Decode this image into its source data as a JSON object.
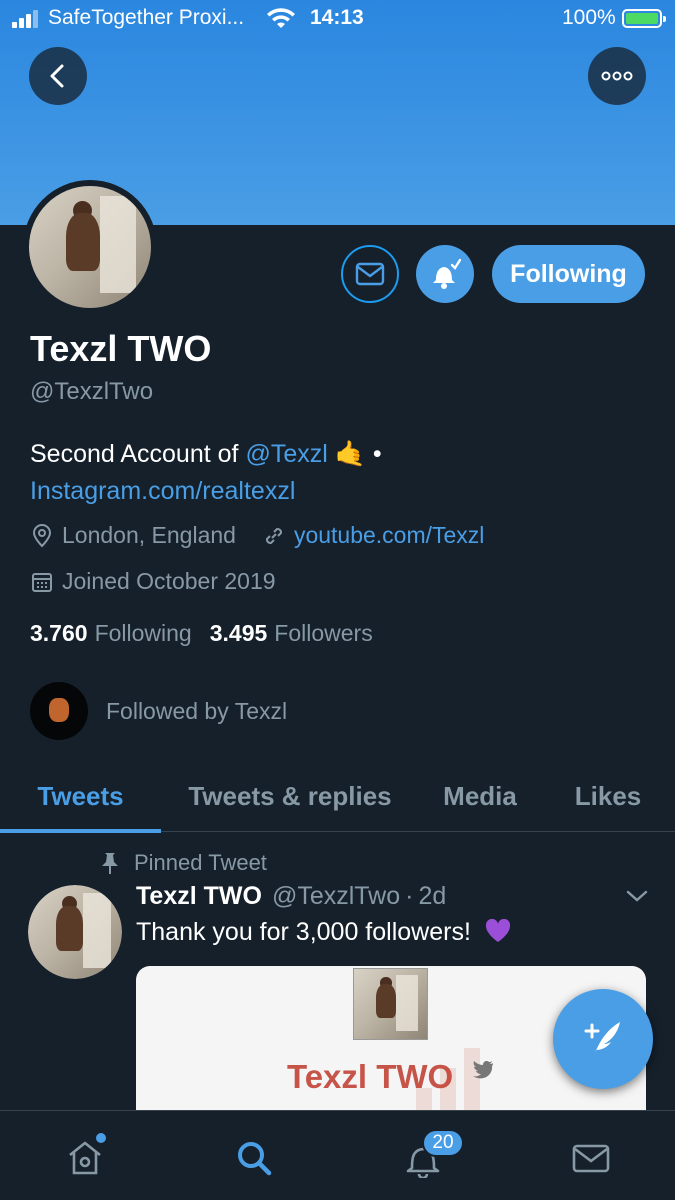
{
  "status_bar": {
    "carrier": "SafeTogether Proxi...",
    "time": "14:13",
    "battery": "100%"
  },
  "profile": {
    "name": "Texzl TWO",
    "handle": "@TexzlTwo",
    "bio_prefix": "Second Account of ",
    "bio_mention": "@Texzl",
    "bio_emoji": "🤙",
    "bio_sep": " • ",
    "bio_link": "Instagram.com/realtexzl",
    "location": "London, England",
    "website": "youtube.com/Texzl",
    "joined": "Joined October 2019",
    "following_count": "3.760",
    "following_label": "Following",
    "followers_count": "3.495",
    "followers_label": "Followers",
    "followed_by": "Followed by Texzl"
  },
  "actions": {
    "following_button": "Following"
  },
  "tabs": [
    {
      "label": "Tweets",
      "active": true
    },
    {
      "label": "Tweets & replies",
      "active": false
    },
    {
      "label": "Media",
      "active": false
    },
    {
      "label": "Likes",
      "active": false
    }
  ],
  "pinned_tweet": {
    "pinned_label": "Pinned Tweet",
    "author_name": "Texzl TWO",
    "author_handle": "@TexzlTwo",
    "separator": "·",
    "time": "2d",
    "text": "Thank you for 3,000 followers!",
    "card_title": "Texzl TWO"
  },
  "bottom_nav": {
    "notification_count": "20"
  },
  "colors": {
    "background": "#15202b",
    "accent": "#4a9ee5",
    "muted_text": "#8899a6",
    "banner": "#2a86df"
  },
  "icons": [
    "back-arrow-icon",
    "more-icon",
    "mail-icon",
    "bell-icon",
    "location-icon",
    "link-icon",
    "calendar-icon",
    "pin-icon",
    "chevron-down-icon",
    "compose-icon",
    "home-icon",
    "search-icon",
    "notifications-icon",
    "messages-icon"
  ]
}
